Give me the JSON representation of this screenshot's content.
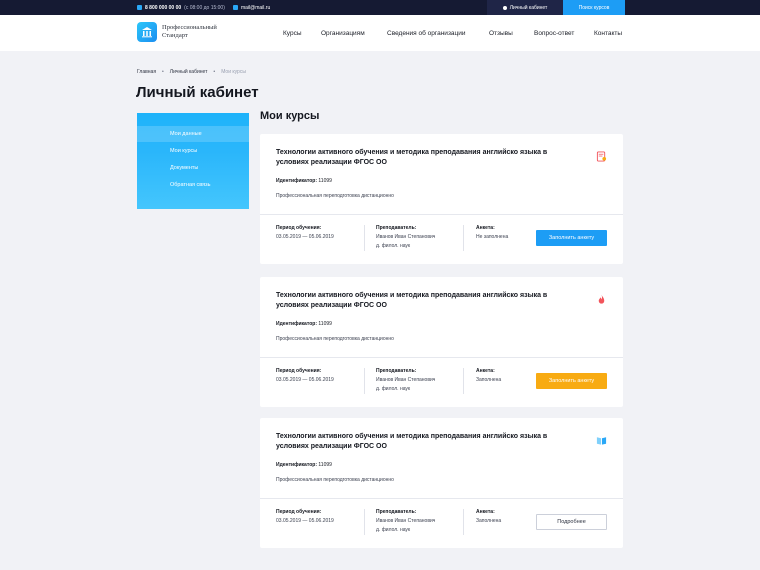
{
  "topbar": {
    "phone": "8 800 000 00 00",
    "hours": "(с 08:00 до 15:00)",
    "email": "mail@mail.ru",
    "cabinet": "Личный кабинет",
    "search_courses": "Поиск курсов"
  },
  "header": {
    "logo_line1": "Профессиональный",
    "logo_line2": "Стандарт",
    "nav": [
      "Курсы",
      "Организациям",
      "Сведения об организации",
      "Отзывы",
      "Вопрос-ответ",
      "Контакты"
    ]
  },
  "breadcrumb": [
    "Главная",
    "Личный кабинет",
    "Мои курсы"
  ],
  "page_title": "Личный кабинет",
  "sidebar": {
    "items": [
      {
        "label": "Мои данные",
        "active": true
      },
      {
        "label": "Мои курсы",
        "active": false
      },
      {
        "label": "Документы",
        "active": false
      },
      {
        "label": "Обратная связь",
        "active": false
      }
    ]
  },
  "section_title": "Мои курсы",
  "labels": {
    "identifier": "Идентификатор:",
    "period": "Период обучения:",
    "teacher": "Преподаватель:",
    "survey": "Анкета:"
  },
  "courses": [
    {
      "title": "Технологии активного обучения и методика преподавания английско языка в условиях реализации ФГОС ОО",
      "icon": "certificate-icon",
      "id": "11099",
      "type": "Профессиональная переподготовка дистанционно",
      "period": "03.05.2019 — 05.06.2019",
      "teacher_name": "Иванов Иван Степанович",
      "teacher_degree": "д. филол. наук",
      "survey_status": "Не заполнена",
      "button": "Заполнить анкету",
      "button_style": "blue"
    },
    {
      "title": "Технологии активного обучения и методика преподавания английско языка в условиях реализации ФГОС ОО",
      "icon": "fire-icon",
      "id": "11099",
      "type": "Профессиональная переподготовка дистанционно",
      "period": "03.05.2019 — 05.06.2019",
      "teacher_name": "Иванов Иван Степанович",
      "teacher_degree": "д. филол. наук",
      "survey_status": "Заполнена",
      "button": "Заполнить анкету",
      "button_style": "orange"
    },
    {
      "title": "Технологии активного обучения и методика преподавания английско языка в условиях реализации ФГОС ОО",
      "icon": "book-icon",
      "id": "11099",
      "type": "Профессиональная переподготовка дистанционно",
      "period": "03.05.2019 — 05.06.2019",
      "teacher_name": "Иванов Иван Степанович",
      "teacher_degree": "д. филол. наук",
      "survey_status": "Заполнена",
      "button": "Подробнее",
      "button_style": "outline"
    }
  ],
  "colors": {
    "primary_blue": "#1d9df5",
    "orange": "#f8ab12",
    "dark": "#151a33",
    "background": "#f1f2f6"
  }
}
